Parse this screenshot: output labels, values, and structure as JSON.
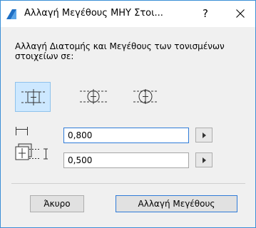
{
  "titlebar": {
    "title": "Αλλαγή Μεγέθους ΜΗΥ Στοι...",
    "help_label": "?",
    "app_icon": "archicad-icon",
    "close_icon": "close-icon"
  },
  "description": "Αλλαγή Διατομής και Μεγέθους των τονισμένων στοιχείων σε:",
  "shape_options": [
    {
      "icon": "rectangle-opening-icon",
      "selected": true
    },
    {
      "icon": "circle-opening-icon",
      "selected": false
    },
    {
      "icon": "oval-opening-icon",
      "selected": false
    }
  ],
  "dimensions": {
    "width_value": "0,800",
    "height_value": "0,500",
    "width_icon": "width-dimension-icon",
    "height_icon": "height-dimension-icon"
  },
  "buttons": {
    "cancel_label": "Άκυρο",
    "resize_label": "Αλλαγή Μεγέθους"
  },
  "colors": {
    "accent": "#2f7bd8",
    "selection": "#cde8ff",
    "window_border": "#3b8fd6"
  }
}
